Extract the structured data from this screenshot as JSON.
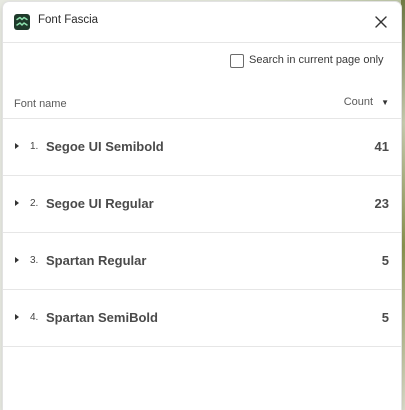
{
  "app": {
    "title": "Font Fascia",
    "logo_icon": "font-fascia-logo-icon",
    "close_icon": "close-icon"
  },
  "filter": {
    "checkbox_label": "Search in current page only",
    "checked": false
  },
  "columns": {
    "name_label": "Font name",
    "count_label": "Count",
    "sort_icon": "caret-down-icon"
  },
  "fonts": [
    {
      "index": "1.",
      "name": "Segoe UI Semibold",
      "count": "41"
    },
    {
      "index": "2.",
      "name": "Segoe UI Regular",
      "count": "23"
    },
    {
      "index": "3.",
      "name": "Spartan Regular",
      "count": "5"
    },
    {
      "index": "4.",
      "name": "Spartan SemiBold",
      "count": "5"
    }
  ],
  "colors": {
    "logo_bg": "#1f3a2b",
    "logo_fg": "#8fe3b0"
  }
}
